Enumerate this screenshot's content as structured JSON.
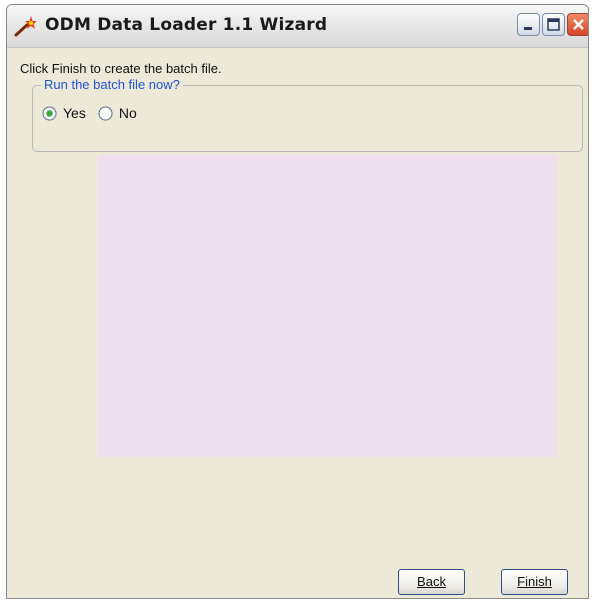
{
  "window": {
    "title": "ODM Data Loader 1.1 Wizard",
    "icon": "wand-icon",
    "controls": [
      "minimize-icon",
      "maximize-icon",
      "close-icon"
    ]
  },
  "content": {
    "instruction": "Click Finish to create the batch file.",
    "group": {
      "legend": "Run the batch file now?",
      "options": [
        {
          "label": "Yes",
          "selected": true
        },
        {
          "label": "No",
          "selected": false
        }
      ]
    }
  },
  "buttons": {
    "back_label": "Back",
    "finish_label": "Finish"
  },
  "colors": {
    "window_bg": "#ece9d8",
    "legend_text": "#2254d4",
    "preview_bg": "#eedfee",
    "close_button": "#d2462a",
    "radio_selected": "#3aa83a"
  }
}
